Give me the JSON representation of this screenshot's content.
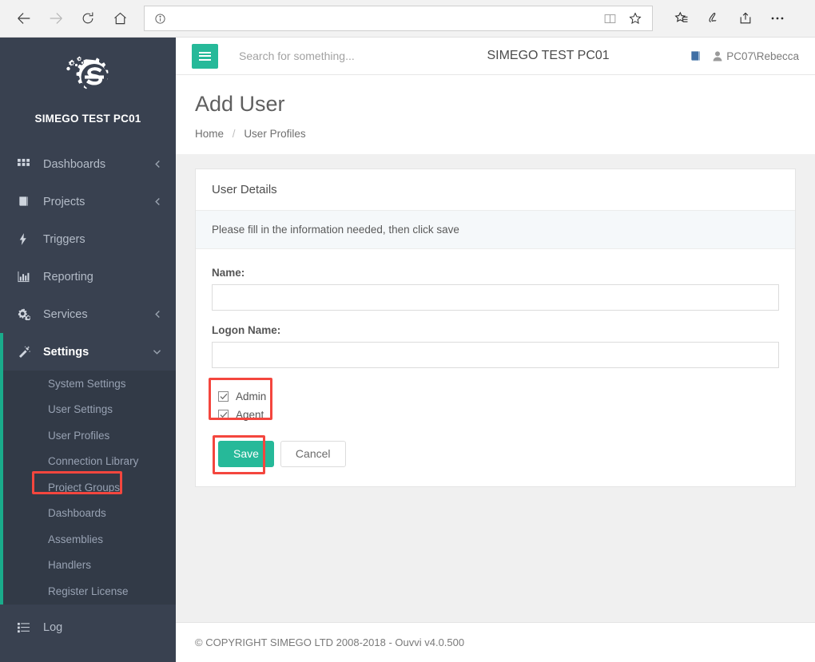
{
  "browser": {
    "back_icon": "arrow-left-icon",
    "forward_icon": "arrow-right-icon",
    "refresh_icon": "refresh-icon",
    "home_icon": "home-icon",
    "address_value": "",
    "address_placeholder": "",
    "info_icon": "info-icon",
    "reading_view_icon": "book-icon",
    "favorite_icon": "star-icon",
    "hub_icon": "favorites-hub-icon",
    "notes_icon": "web-note-icon",
    "share_icon": "share-icon",
    "more_icon": "more-ellipsis-icon"
  },
  "sidebar": {
    "brand_title": "SIMEGO TEST PC01",
    "items": [
      {
        "label": "Dashboards",
        "icon": "grid-icon",
        "chevron": "left"
      },
      {
        "label": "Projects",
        "icon": "book-icon",
        "chevron": "left"
      },
      {
        "label": "Triggers",
        "icon": "bolt-icon",
        "chevron": "none"
      },
      {
        "label": "Reporting",
        "icon": "bar-chart-icon",
        "chevron": "none"
      },
      {
        "label": "Services",
        "icon": "gears-icon",
        "chevron": "left"
      },
      {
        "label": "Settings",
        "icon": "magic-wand-icon",
        "chevron": "down"
      }
    ],
    "submenu": [
      {
        "label": "System Settings"
      },
      {
        "label": "User Settings"
      },
      {
        "label": "User Profiles"
      },
      {
        "label": "Connection Library"
      },
      {
        "label": "Project Groups"
      },
      {
        "label": "Dashboards"
      },
      {
        "label": "Assemblies"
      },
      {
        "label": "Handlers"
      },
      {
        "label": "Register License"
      }
    ],
    "log": {
      "label": "Log",
      "icon": "list-icon"
    }
  },
  "topbar": {
    "menu_toggle_icon": "hamburger-icon",
    "search_placeholder": "Search for something...",
    "search_value": "",
    "title": "SIMEGO TEST PC01",
    "help_icon": "book-icon",
    "user_icon": "user-icon",
    "username": "PC07\\Rebecca"
  },
  "page": {
    "title": "Add User",
    "breadcrumb": {
      "home": "Home",
      "separator": "/",
      "current": "User Profiles"
    }
  },
  "card": {
    "header": "User Details",
    "note": "Please fill in the information needed, then click save",
    "fields": [
      {
        "label": "Name:",
        "value": "",
        "placeholder": ""
      },
      {
        "label": "Logon Name:",
        "value": "",
        "placeholder": ""
      }
    ],
    "checkboxes": [
      {
        "label": "Admin",
        "checked": true
      },
      {
        "label": "Agent",
        "checked": true
      }
    ],
    "save_label": "Save",
    "cancel_label": "Cancel"
  },
  "footer": {
    "text": "© COPYRIGHT SIMEGO LTD 2008-2018 - Ouvvi v4.0.500"
  },
  "colors": {
    "sidebar_bg": "#394150",
    "submenu_bg": "#323a47",
    "accent_teal": "#26b999",
    "accent_teal_dark": "#1aab8b",
    "annotation_red": "#f4463e",
    "content_bg": "#f0f0f0"
  }
}
